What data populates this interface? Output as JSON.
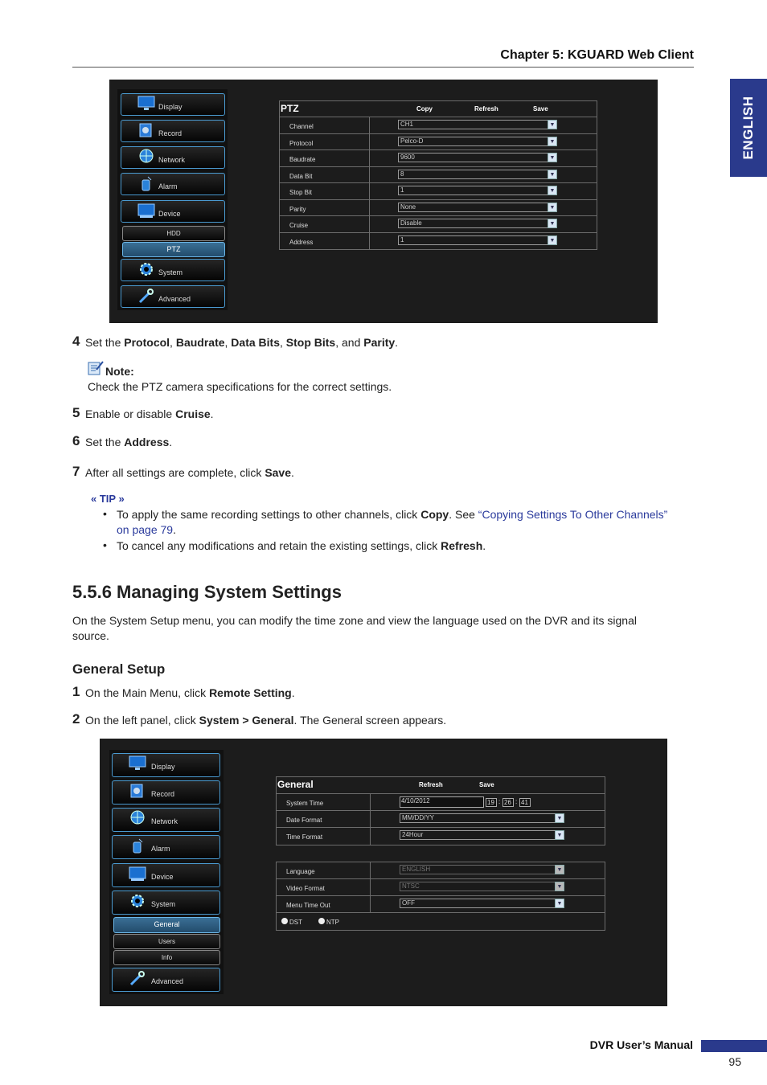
{
  "header": {
    "chapter": "Chapter 5: KGUARD Web Client",
    "language_tab": "ENGLISH"
  },
  "nav": {
    "display": "Display",
    "record": "Record",
    "network": "Network",
    "alarm": "Alarm",
    "device": "Device",
    "system": "System",
    "advanced": "Advanced"
  },
  "ptz_screen": {
    "sub_hdd": "HDD",
    "sub_ptz": "PTZ",
    "panel_title": "PTZ",
    "actions": {
      "copy": "Copy",
      "refresh": "Refresh",
      "save": "Save"
    },
    "rows": [
      {
        "label": "Channel",
        "value": "CH1"
      },
      {
        "label": "Protocol",
        "value": "Pelco-D"
      },
      {
        "label": "Baudrate",
        "value": "9600"
      },
      {
        "label": "Data Bit",
        "value": "8"
      },
      {
        "label": "Stop Bit",
        "value": "1"
      },
      {
        "label": "Parity",
        "value": "None"
      },
      {
        "label": "Cruise",
        "value": "Disable"
      },
      {
        "label": "Address",
        "value": "1"
      }
    ]
  },
  "steps_a": {
    "s4": {
      "num": "4",
      "pre": "Set the ",
      "b1": "Protocol",
      "c1": ", ",
      "b2": "Baudrate",
      "c2": ", ",
      "b3": "Data Bits",
      "c3": ", ",
      "b4": "Stop Bits",
      "c4": ", and ",
      "b5": "Parity",
      "end": "."
    },
    "note_label": "Note:",
    "note_text": "Check the PTZ camera specifications for the correct settings.",
    "s5": {
      "num": "5",
      "pre": "Enable or disable ",
      "b": "Cruise",
      "end": "."
    },
    "s6": {
      "num": "6",
      "pre": "Set the ",
      "b": "Address",
      "end": "."
    },
    "s7": {
      "num": "7",
      "pre": "After all settings are complete, click ",
      "b": "Save",
      "end": "."
    }
  },
  "tip": {
    "label": "« TIP »",
    "b1": {
      "pre": "To apply the same recording settings to other channels, click ",
      "b": "Copy",
      "mid": ". See ",
      "link": "“Copying Settings To Other Channels”",
      "link2": "on page 79",
      "end": "."
    },
    "b2": {
      "pre": "To cancel any modifications and retain the existing settings, click ",
      "b": "Refresh",
      "end": "."
    }
  },
  "section": {
    "title": "5.5.6 Managing System Settings",
    "intro_1": "On the System Setup menu, you can modify the time zone and view the language used on the DVR and its signal",
    "intro_2": "source.",
    "subtitle": "General Setup",
    "s1": {
      "num": "1",
      "pre": "On the Main Menu, click ",
      "b": "Remote Setting",
      "end": "."
    },
    "s2": {
      "num": "2",
      "pre": "On the left panel, click ",
      "b": "System > General",
      "end": ". The General screen appears."
    }
  },
  "general_screen": {
    "sub_general": "General",
    "sub_users": "Users",
    "sub_info": "Info",
    "panel_title": "General",
    "actions": {
      "refresh": "Refresh",
      "save": "Save"
    },
    "system_time_label": "System Time",
    "date": "4/10/2012",
    "hour": "19",
    "minute": "26",
    "second": "41",
    "date_format_label": "Date Format",
    "date_format": "MM/DD/YY",
    "time_format_label": "Time Format",
    "time_format": "24Hour",
    "language_label": "Language",
    "language": "ENGLISH",
    "video_format_label": "Video Format",
    "video_format": "NTSC",
    "menu_timeout_label": "Menu Time Out",
    "menu_timeout": "OFF",
    "dst": "DST",
    "ntp": "NTP"
  },
  "footer": {
    "manual": "DVR User’s Manual",
    "page": "95"
  }
}
